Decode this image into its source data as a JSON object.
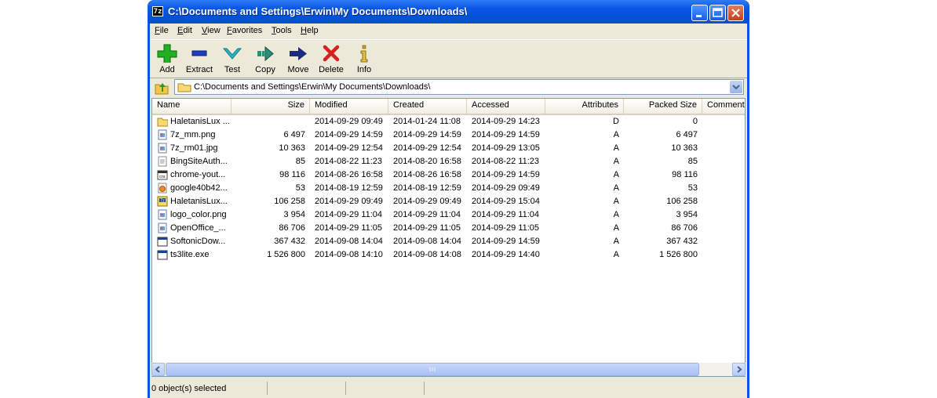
{
  "window": {
    "title": "C:\\Documents and Settings\\Erwin\\My Documents\\Downloads\\",
    "app_icon_text": "7z",
    "minimize_icon": "minimize-icon",
    "maximize_icon": "maximize-icon",
    "close_icon": "close-icon"
  },
  "menu": [
    {
      "label": "File",
      "mnemonic": "F",
      "rest": "ile"
    },
    {
      "label": "Edit",
      "mnemonic": "E",
      "rest": "dit"
    },
    {
      "label": "View",
      "mnemonic": "V",
      "rest": "iew"
    },
    {
      "label": "Favorites",
      "mnemonic": "F",
      "rest": "avorites",
      "pre": ""
    },
    {
      "label": "Tools",
      "mnemonic": "T",
      "rest": "ools"
    },
    {
      "label": "Help",
      "mnemonic": "H",
      "rest": "elp"
    }
  ],
  "toolbar": [
    {
      "label": "Add",
      "icon": "plus-icon",
      "color": "#22b022"
    },
    {
      "label": "Extract",
      "icon": "minus-icon",
      "color": "#1d3fbf"
    },
    {
      "label": "Test",
      "icon": "checkmark-icon",
      "color": "#29b6c9"
    },
    {
      "label": "Copy",
      "icon": "copy-arrow-icon",
      "color": "#2a8f7a"
    },
    {
      "label": "Move",
      "icon": "move-arrow-icon",
      "color": "#1a2a80"
    },
    {
      "label": "Delete",
      "icon": "delete-x-icon",
      "color": "#d81e1e"
    },
    {
      "label": "Info",
      "icon": "info-icon",
      "color": "#c9a416"
    }
  ],
  "address": {
    "path": "C:\\Documents and Settings\\Erwin\\My Documents\\Downloads\\"
  },
  "columns": [
    "Name",
    "Size",
    "Modified",
    "Created",
    "Accessed",
    "Attributes",
    "Packed Size",
    "Comment"
  ],
  "files": [
    {
      "name": "HaletanisLux ...",
      "size": "",
      "modified": "2014-09-29 09:49",
      "created": "2014-01-24 11:08",
      "accessed": "2014-09-29 14:23",
      "attributes": "D",
      "packed": "0",
      "icon": "folder-icon"
    },
    {
      "name": "7z_mm.png",
      "size": "6 497",
      "modified": "2014-09-29 14:59",
      "created": "2014-09-29 14:59",
      "accessed": "2014-09-29 14:59",
      "attributes": "A",
      "packed": "6 497",
      "icon": "image-file-icon"
    },
    {
      "name": "7z_rm01.jpg",
      "size": "10 363",
      "modified": "2014-09-29 12:54",
      "created": "2014-09-29 12:54",
      "accessed": "2014-09-29 13:05",
      "attributes": "A",
      "packed": "10 363",
      "icon": "image-file-icon"
    },
    {
      "name": "BingSiteAuth...",
      "size": "85",
      "modified": "2014-08-22 11:23",
      "created": "2014-08-20 16:58",
      "accessed": "2014-08-22 11:23",
      "attributes": "A",
      "packed": "85",
      "icon": "xml-file-icon"
    },
    {
      "name": "chrome-yout...",
      "size": "98 116",
      "modified": "2014-08-26 16:58",
      "created": "2014-08-26 16:58",
      "accessed": "2014-09-29 14:59",
      "attributes": "A",
      "packed": "98 116",
      "icon": "crx-file-icon"
    },
    {
      "name": "google40b42...",
      "size": "53",
      "modified": "2014-08-19 12:59",
      "created": "2014-08-19 12:59",
      "accessed": "2014-09-29 09:49",
      "attributes": "A",
      "packed": "53",
      "icon": "html-file-icon"
    },
    {
      "name": "HaletanisLux...",
      "size": "106 258",
      "modified": "2014-09-29 09:49",
      "created": "2014-09-29 09:49",
      "accessed": "2014-09-29 15:04",
      "attributes": "A",
      "packed": "106 258",
      "icon": "archive-file-icon"
    },
    {
      "name": "logo_color.png",
      "size": "3 954",
      "modified": "2014-09-29 11:04",
      "created": "2014-09-29 11:04",
      "accessed": "2014-09-29 11:04",
      "attributes": "A",
      "packed": "3 954",
      "icon": "image-file-icon"
    },
    {
      "name": "OpenOffice_...",
      "size": "86 706",
      "modified": "2014-09-29 11:05",
      "created": "2014-09-29 11:05",
      "accessed": "2014-09-29 11:05",
      "attributes": "A",
      "packed": "86 706",
      "icon": "image-file-icon"
    },
    {
      "name": "SoftonicDow...",
      "size": "367 432",
      "modified": "2014-09-08 14:04",
      "created": "2014-09-08 14:04",
      "accessed": "2014-09-29 14:59",
      "attributes": "A",
      "packed": "367 432",
      "icon": "exe-file-icon"
    },
    {
      "name": "ts3lite.exe",
      "size": "1 526 800",
      "modified": "2014-09-08 14:10",
      "created": "2014-09-08 14:08",
      "accessed": "2014-09-29 14:40",
      "attributes": "A",
      "packed": "1 526 800",
      "icon": "exe-file-icon"
    }
  ],
  "status": {
    "selected": "0 object(s) selected"
  }
}
